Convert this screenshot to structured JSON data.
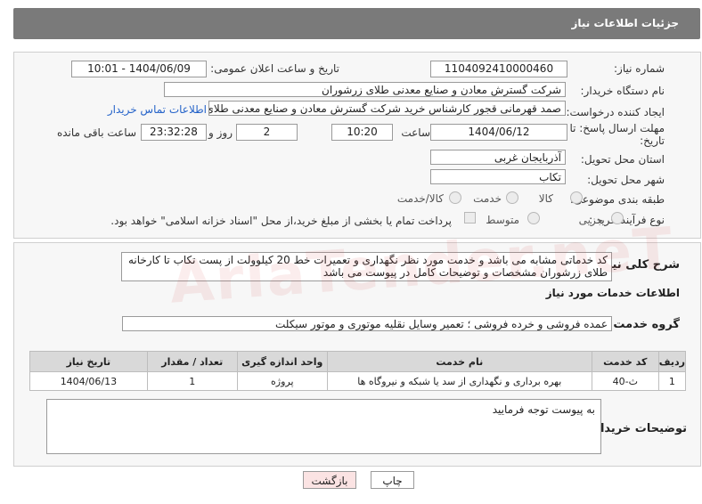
{
  "header": {
    "title": "جزئیات اطلاعات نیاز"
  },
  "form": {
    "need_number": {
      "label": "شماره نیاز:",
      "value": "1104092410000460"
    },
    "announce_datetime": {
      "label": "تاریخ و ساعت اعلان عمومی:",
      "value": "1404/06/09 - 10:01"
    },
    "buyer_org": {
      "label": "نام دستگاه خریدار:",
      "value": "شرکت گسترش معادن و صنایع معدنی طلای زرشوران"
    },
    "requester": {
      "label": "ایجاد کننده درخواست:",
      "value": "صمد قهرمانی قجور کارشناس خرید شرکت گسترش معادن و صنایع معدنی طلای",
      "contact_link": "اطلاعات تماس خریدار"
    },
    "deadline": {
      "label_line1": "مهلت ارسال پاسخ: تا",
      "label_line2": "تاریخ:",
      "date": "1404/06/12",
      "time_label": "ساعت",
      "time": "10:20",
      "days": "2",
      "days_label": "روز و",
      "remaining": "23:32:28",
      "remaining_label": "ساعت باقی مانده"
    },
    "province": {
      "label": "استان محل تحویل:",
      "value": "آذربایجان غربی"
    },
    "city": {
      "label": "شهر محل تحویل:",
      "value": "تکاب"
    },
    "category": {
      "label": "طبقه بندی موضوعی:",
      "options": [
        "کالا",
        "خدمت",
        "کالا/خدمت"
      ]
    },
    "purchase_type": {
      "label": "نوع فرآیند خرید :",
      "options": [
        "جزیی",
        "متوسط"
      ],
      "note": "پرداخت تمام یا بخشی از مبلغ خرید،از محل \"اسناد خزانه اسلامی\" خواهد بود."
    }
  },
  "summary": {
    "label": "شرح کلی نیاز:",
    "text_line1": "کد خدماتی مشابه می باشد و خدمت مورد نظر نگهداری و تعمیرات خط 20 کیلوولت از پست تکاب تا کارخانه",
    "text_line2": "طلای زرشوران مشخصات و توضیحات کامل در پیوست می باشد"
  },
  "services": {
    "title": "اطلاعات خدمات مورد نیاز",
    "group_label": "گروه خدمت:",
    "group_value": "عمده فروشی و خرده فروشی ؛ تعمیر وسایل نقلیه موتوری و موتور سیکلت",
    "columns": [
      "ردیف",
      "کد خدمت",
      "نام خدمت",
      "واحد اندازه گیری",
      "تعداد / مقدار",
      "تاریخ نیاز"
    ],
    "rows": [
      {
        "row": "1",
        "code": "ث-40",
        "name": "بهره برداری و نگهداری از سد یا شبکه و نیروگاه ها",
        "unit": "پروژه",
        "qty": "1",
        "date": "1404/06/13"
      }
    ]
  },
  "buyer_notes": {
    "label": "توضیحات خریدار:",
    "value": "به پیوست توجه فرمایید"
  },
  "buttons": {
    "print": "چاپ",
    "back": "بازگشت"
  },
  "watermark": "AriaTender.neT",
  "colors": {
    "header_bg": "#7a7a7a",
    "link": "#2563c9",
    "back_btn_bg": "#fbe3e3"
  }
}
